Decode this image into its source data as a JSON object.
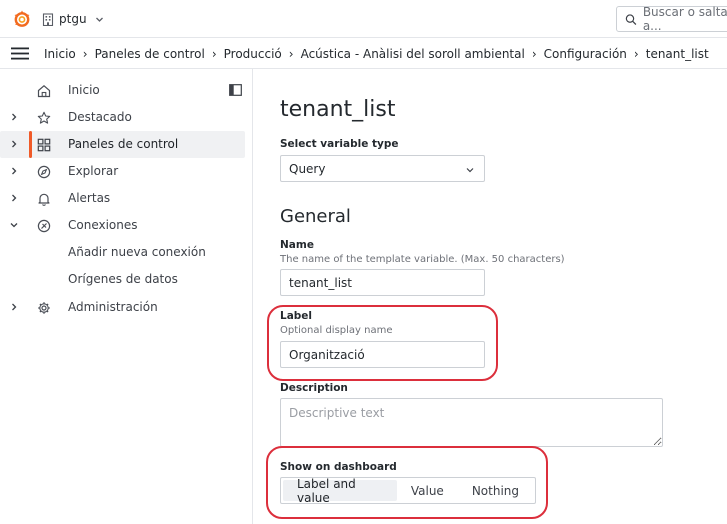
{
  "topbar": {
    "org_name": "ptgu",
    "search_placeholder": "Buscar o saltar a..."
  },
  "breadcrumb": [
    "Inicio",
    "Paneles de control",
    "Producció",
    "Acústica - Anàlisi del soroll ambiental",
    "Configuración",
    "tenant_list"
  ],
  "sidebar": {
    "items": [
      {
        "label": "Inicio",
        "icon": "home-icon",
        "caret": false
      },
      {
        "label": "Destacado",
        "icon": "star-icon",
        "caret": true
      },
      {
        "label": "Paneles de control",
        "icon": "apps-icon",
        "caret": true,
        "active": true
      },
      {
        "label": "Explorar",
        "icon": "compass-icon",
        "caret": true
      },
      {
        "label": "Alertas",
        "icon": "bell-icon",
        "caret": true
      },
      {
        "label": "Conexiones",
        "icon": "plug-icon",
        "caret": true,
        "expanded": true
      },
      {
        "label": "Añadir nueva conexión",
        "sub": true
      },
      {
        "label": "Orígenes de datos",
        "sub": true
      },
      {
        "label": "Administración",
        "icon": "cog-icon",
        "caret": true
      }
    ]
  },
  "main": {
    "title": "tenant_list",
    "variable_type": {
      "label": "Select variable type",
      "value": "Query"
    },
    "general_heading": "General",
    "name": {
      "label": "Name",
      "description": "The name of the template variable. (Max. 50 characters)",
      "value": "tenant_list"
    },
    "label": {
      "label": "Label",
      "description": "Optional display name",
      "value": "Organització"
    },
    "description": {
      "label": "Description",
      "placeholder": "Descriptive text",
      "value": ""
    },
    "show_on_dashboard": {
      "label": "Show on dashboard",
      "options": [
        "Label and value",
        "Value",
        "Nothing"
      ],
      "selected": "Label and value"
    }
  },
  "colors": {
    "accent": "#f05a28",
    "annotation": "#dc2f3c"
  }
}
